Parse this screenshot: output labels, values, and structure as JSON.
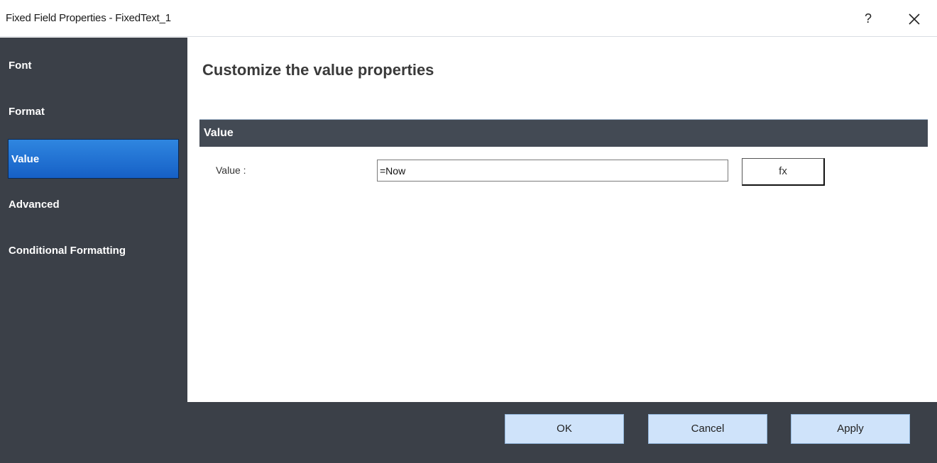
{
  "window": {
    "title": "Fixed Field Properties - FixedText_1",
    "help_label": "?",
    "close_icon": "close-icon"
  },
  "sidebar": {
    "items": [
      {
        "label": "Font",
        "active": false
      },
      {
        "label": "Format",
        "active": false
      },
      {
        "label": "Value",
        "active": true
      },
      {
        "label": "Advanced",
        "active": false
      },
      {
        "label": "Conditional Formatting",
        "active": false
      }
    ]
  },
  "main": {
    "heading": "Customize the value properties",
    "section_title": "Value",
    "value_label": "Value :",
    "value_input": "=Now",
    "fx_label": "fx"
  },
  "footer": {
    "ok_label": "OK",
    "cancel_label": "Cancel",
    "apply_label": "Apply"
  },
  "colors": {
    "sidebar_bg": "#3b4048",
    "active_item": "#1f6fd6",
    "section_bar": "#434a54",
    "footer_button": "#cfe3fa"
  }
}
